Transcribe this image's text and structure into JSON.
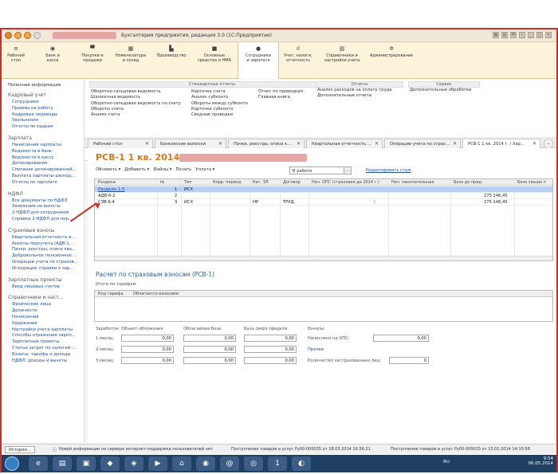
{
  "window": {
    "title": "Бухгалтерия предприятия, редакция 3.0  (1С:Предприятие)"
  },
  "sections": [
    {
      "label1": "Рабочий",
      "label2": "стол",
      "icon": "menu-icon"
    },
    {
      "label1": "Банк и",
      "label2": "касса",
      "icon": "bank-icon"
    },
    {
      "label1": "Покупки и",
      "label2": "продажи",
      "icon": "cart-icon"
    },
    {
      "label1": "Номенклатура",
      "label2": "и склад",
      "icon": "grid-icon"
    },
    {
      "label1": "Производство",
      "label2": "",
      "icon": "factory-icon"
    },
    {
      "label1": "Основные",
      "label2": "средства и НМА",
      "icon": "truck-icon"
    },
    {
      "label1": "Сотрудники",
      "label2": "и зарплата",
      "icon": "person-icon"
    },
    {
      "label1": "Учет, налоги,",
      "label2": "отчетность",
      "icon": "chart-icon"
    },
    {
      "label1": "Справочники и",
      "label2": "настройки учета",
      "icon": "book-icon"
    },
    {
      "label1": "Администрирование",
      "label2": "",
      "icon": "gear-icon"
    }
  ],
  "sidebar": {
    "top": "Полезная информация",
    "groups": [
      {
        "title": "Кадровый учет",
        "items": [
          "Сотрудники",
          "Приемы на работу",
          "Кадровые переводы",
          "Увольнения",
          "Отчеты по кадрам"
        ]
      },
      {
        "title": "Зарплата",
        "items": [
          "Начисления зарплаты",
          "Ведомости в банк",
          "Ведомости в кассу",
          "Депонирования",
          "Списание депонированной...",
          "Выплата зарплаты раскод...",
          "Отчеты по зарплате"
        ]
      },
      {
        "title": "НДФЛ",
        "items": [
          "Все документы по НДФЛ",
          "Заявления на вычеты",
          "2-НДФЛ для сотрудников",
          "Справки 2-НДФЛ для пер..."
        ]
      },
      {
        "title": "Страховые взносы",
        "items": [
          "Квартальная отчетность в ...",
          "Анкеты персучета (АДВ-1...",
          "Пачки, реестры, описи ква...",
          "Добровольное пенсионное ...",
          "Операции учета по страхов...",
          "Исходящие справки о зар..."
        ]
      },
      {
        "title": "Зарплатные проекты",
        "items": [
          "Ввод лицевых счетов"
        ]
      },
      {
        "title": "Справочники и наст...",
        "items": [
          "Физические лица",
          "Должности",
          "Начисления",
          "Удержания",
          "Настройки учета зарплаты",
          "Способы отражения зарпл...",
          "Зарплатные проекты",
          "Статьи затрат по налогам ...",
          "Взносы: тарифы и доходы",
          "НДФЛ: доходы и вычеты"
        ]
      }
    ]
  },
  "panel": {
    "col1": {
      "items": [
        "Оборотно-сальдовая ведомость",
        "Шахматная ведомость",
        "Оборотно-сальдовая ведомость по счету",
        "Обороты счета",
        "Анализ счета"
      ]
    },
    "col2": {
      "header": "Стандартные отчеты",
      "items": [
        "Карточка счета",
        "Анализ субконто",
        "Обороты между субконто",
        "Карточка субконто",
        "Сводные проводки"
      ]
    },
    "col3": {
      "items": [
        "Отчет по проводкам",
        "Главная книга"
      ]
    },
    "col4": {
      "header": "Отчеты",
      "items": [
        "Анализ расходов на оплату труда",
        "Дополнительные отчеты"
      ]
    },
    "col5": {
      "header": "Сервис",
      "items": [
        "Дополнительные обработки"
      ]
    }
  },
  "tabs": [
    "Рабочий стол",
    "Банковские выписки",
    "Пачки, реестры, описи к...",
    "Квартальная отчетность ...",
    "Операции учета по страх...",
    "РСВ-1 1 кв. 2014 г. / Хар..."
  ],
  "document": {
    "title": "РСВ-1 1 кв. 2014 г. /",
    "toolbar": [
      "Обновить ▾",
      "Добавить ▾",
      "Файлы ▾",
      "Печать",
      "Уплата ▾"
    ],
    "status": "В работе",
    "status_btn": "...",
    "edit_link": "Редактировать стаж",
    "columns": [
      "Разделы",
      "№",
      "Тип",
      "Корр. период",
      "Кат. ЗЛ",
      "Договор",
      "Нач. ОПС (страховая до 2014 г.)",
      "Нач. накопительная",
      "База до пред.",
      "База свыше п"
    ],
    "rows": [
      {
        "section": "Разделы 1-5",
        "num": "1",
        "type": "ИСХ",
        "corr": "",
        "cat": "",
        "contract": "",
        "ops": "",
        "acc": "",
        "base": "",
        "over": ""
      },
      {
        "section": "АДВ-6-2",
        "num": "2",
        "type": "",
        "corr": "",
        "cat": "",
        "contract": "",
        "ops": "",
        "acc": "",
        "base": "275 146,45",
        "over": ""
      },
      {
        "section": "СЗВ-6-4",
        "num": "3",
        "type": "ИСХ",
        "corr": "",
        "cat": "НР",
        "contract": "ТРУД.",
        "ops": "\\",
        "acc": "",
        "base": "275 146,45",
        "over": ""
      }
    ],
    "section_title": "Расчет по страховым взносам (РСВ-1)",
    "sub_title": "Итоги по тарифам",
    "sub_headers": [
      "Код тарифа",
      "Облагается взносами"
    ],
    "form": {
      "h_earnings": "Заработок:",
      "h_object": "Объект обложения",
      "h_taxable": "Облагаемая база",
      "h_over": "База сверх предела",
      "h_contrib": "Взносы:",
      "months": [
        "1 месяц:",
        "2 месяц:",
        "3 месяц:"
      ],
      "zero": "0,00",
      "ops_label": "Начислено на ОПС:",
      "ops_value": "0,00",
      "other_label": "Прочее:",
      "insured_label": "Количество застрахованных лиц:",
      "insured_value": "0"
    }
  },
  "bottom": {
    "history": "История...",
    "notices": [
      "Новой информации на сервере интернет-поддержки пользователей нет",
      "Поступление товаров и услуг Ру00-000035 от 18.03.2014 16:56:21",
      "Поступление товаров и услуг Ру00-000015 от 13.02.2014 14:10:58"
    ]
  },
  "taskbar": {
    "lang": "RU",
    "time": "9:54",
    "date": "06.05.2014"
  }
}
